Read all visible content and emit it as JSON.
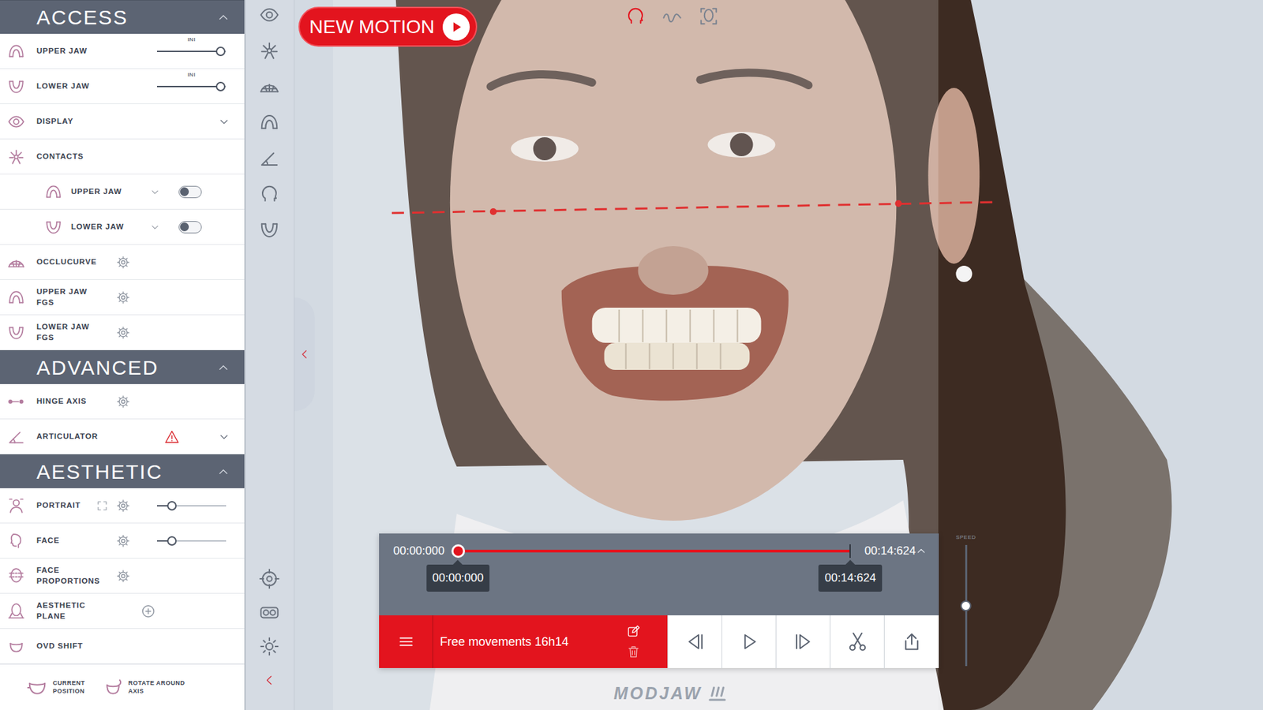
{
  "new_motion": {
    "label": "NEW MOTION"
  },
  "view_modes": [
    {
      "selected": true
    },
    {
      "selected": false
    },
    {
      "selected": false
    }
  ],
  "sidebar": {
    "sections": [
      {
        "title": "ACCESS",
        "expanded": true,
        "items": [
          {
            "kind": "slider",
            "lines": [
              "UPPER JAW"
            ],
            "tag": "INI",
            "level": 0.92
          },
          {
            "kind": "slider",
            "lines": [
              "LOWER JAW"
            ],
            "tag": "INI",
            "level": 0.92
          },
          {
            "kind": "chevron",
            "lines": [
              "DISPLAY"
            ],
            "expanded": false
          },
          {
            "kind": "plain",
            "lines": [
              "CONTACTS"
            ]
          },
          {
            "kind": "toggle",
            "lines": [
              "UPPER JAW"
            ],
            "expanded": false,
            "on": false
          },
          {
            "kind": "toggle",
            "lines": [
              "LOWER JAW"
            ],
            "expanded": false,
            "on": false
          },
          {
            "kind": "gear",
            "lines": [
              "OCCLUCURVE"
            ]
          },
          {
            "kind": "gear",
            "lines": [
              "UPPER JAW",
              "FGS"
            ]
          },
          {
            "kind": "gear",
            "lines": [
              "LOWER JAW",
              "FGS"
            ]
          }
        ]
      },
      {
        "title": "ADVANCED",
        "expanded": true,
        "items": [
          {
            "kind": "gear",
            "lines": [
              "HINGE AXIS"
            ]
          },
          {
            "kind": "warning",
            "lines": [
              "ARTICULATOR"
            ],
            "expanded": false
          }
        ]
      },
      {
        "title": "AESTHETIC",
        "expanded": true,
        "items": [
          {
            "kind": "portrait",
            "lines": [
              "PORTRAIT"
            ],
            "level": 0.22
          },
          {
            "kind": "gear-slider",
            "lines": [
              "FACE"
            ],
            "level": 0.22
          },
          {
            "kind": "gear",
            "lines": [
              "FACE",
              "PROPORTIONS"
            ]
          },
          {
            "kind": "plus",
            "lines": [
              "AESTHETIC",
              "PLANE"
            ]
          },
          {
            "kind": "plain",
            "lines": [
              "OVD SHIFT"
            ]
          }
        ]
      }
    ],
    "actions": [
      {
        "lines": [
          "CURRENT",
          "POSITION"
        ]
      },
      {
        "lines": [
          "ROTATE AROUND",
          "AXIS"
        ]
      }
    ]
  },
  "timeline": {
    "current": "00:00:000",
    "duration": "00:14:624",
    "playhead": 0,
    "expanded": true,
    "markers": [
      {
        "label": "00:00:000",
        "level": 0
      },
      {
        "label": "00:14:624",
        "level": 1
      }
    ]
  },
  "motion": {
    "name": "Free movements 16h14"
  },
  "speed": {
    "label": "SPEED",
    "level": 0.5
  },
  "logo": {
    "text": "MODJAW"
  }
}
